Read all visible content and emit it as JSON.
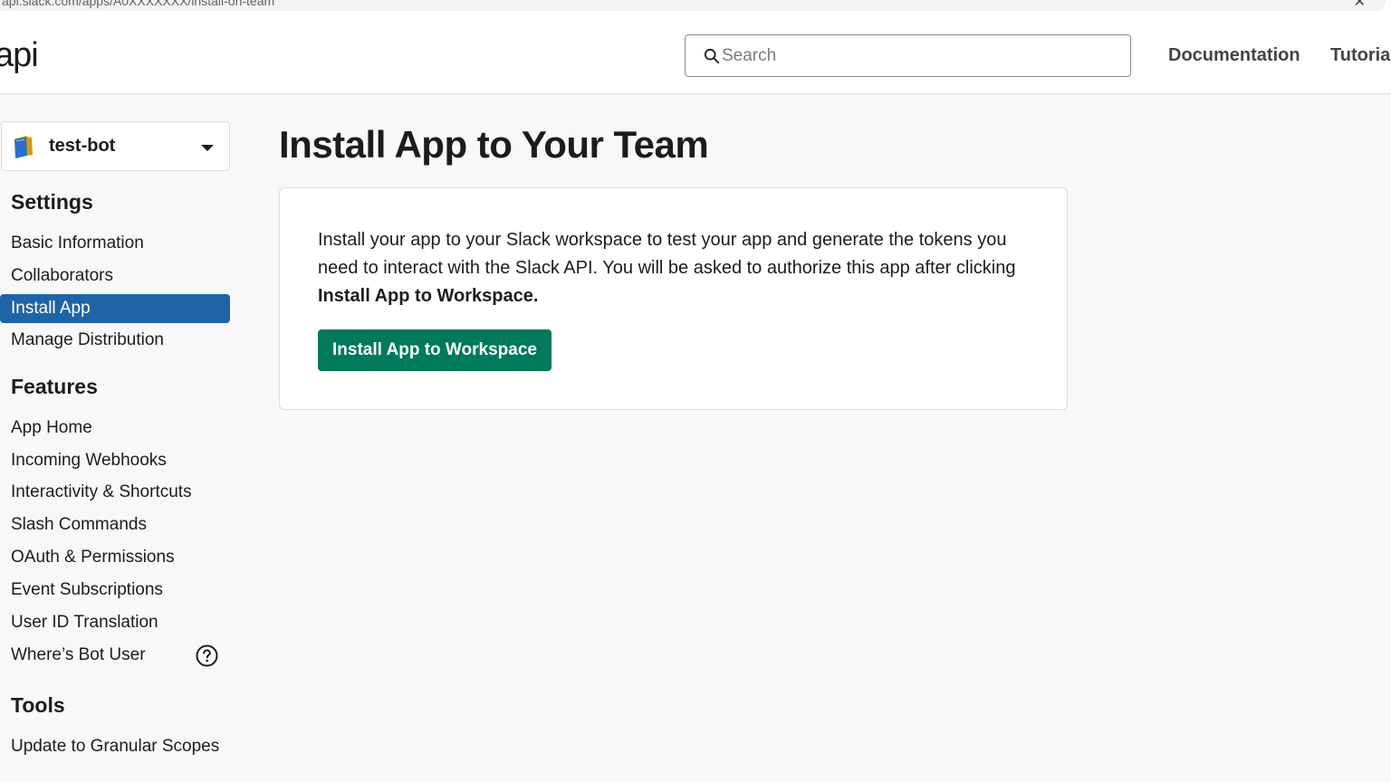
{
  "browser": {
    "url": "api.slack.com/apps/A0XXXXXXX/install-on-team",
    "close_glyph": "✕"
  },
  "header": {
    "logo_text": "api",
    "search": {
      "placeholder": "Search",
      "value": ""
    },
    "nav": {
      "documentation": "Documentation",
      "tutorials": "Tutorials"
    }
  },
  "sidebar": {
    "app_selector": {
      "name": "test-bot",
      "icon": "app-notebook-icon"
    },
    "sections": {
      "settings": {
        "title": "Settings",
        "items": [
          "Basic Information",
          "Collaborators",
          "Install App",
          "Manage Distribution"
        ],
        "active": "Install App"
      },
      "features": {
        "title": "Features",
        "items": [
          "App Home",
          "Incoming Webhooks",
          "Interactivity & Shortcuts",
          "Slash Commands",
          "OAuth & Permissions",
          "Event Subscriptions",
          "User ID Translation",
          "Where’s Bot User"
        ]
      },
      "tools": {
        "title": "Tools",
        "items": [
          "Update to Granular Scopes"
        ]
      }
    }
  },
  "main": {
    "title": "Install App to Your Team",
    "card": {
      "text_before": "Install your app to your Slack workspace to test your app and generate the tokens you need to interact with the Slack API. You will be asked to authorize this app after clicking ",
      "text_bold": "Install App to Workspace.",
      "button_label": "Install App to Workspace"
    }
  },
  "colors": {
    "active_nav": "#1e64a7",
    "primary_button": "#007a5a",
    "page_background": "#f8f8f8"
  }
}
